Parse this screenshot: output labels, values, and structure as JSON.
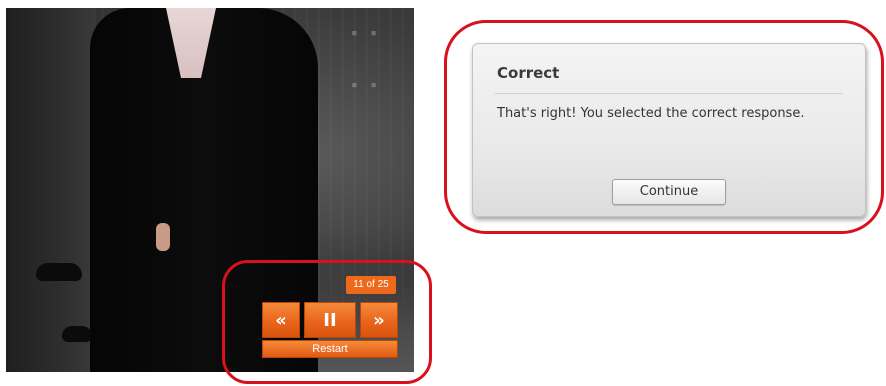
{
  "slide": {
    "counter": "11 of 25",
    "controls": {
      "prev_icon": "double-chevron-left-icon",
      "prev_glyph": "«",
      "pause_icon": "pause-icon",
      "pause_glyph": "II",
      "next_icon": "double-chevron-right-icon",
      "next_glyph": "»",
      "restart_label": "Restart"
    }
  },
  "dialog": {
    "title": "Correct",
    "message": "That's right!  You selected the correct response.",
    "continue_label": "Continue"
  },
  "colors": {
    "accent_orange": "#e8621a",
    "highlight_red": "#d8111c"
  }
}
